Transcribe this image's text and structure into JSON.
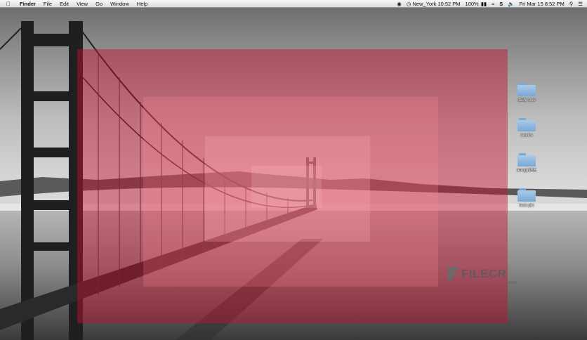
{
  "menubar": {
    "app": "Finder",
    "menus": [
      "File",
      "Edit",
      "View",
      "Go",
      "Window",
      "Help"
    ],
    "clock_city": "New_York 10:52 PM",
    "battery": "100%",
    "date_time": "Fri Mar 15  8:52 PM"
  },
  "desktop": {
    "folders": [
      {
        "name": "daily use"
      },
      {
        "name": "works"
      },
      {
        "name": "tempDSE"
      },
      {
        "name": "test-pic"
      }
    ]
  },
  "watermark": {
    "text": "FILECR",
    "sub": ".com"
  },
  "colors": {
    "overlay_red": "#c8102e",
    "folder_blue": "#8fb8dd"
  }
}
